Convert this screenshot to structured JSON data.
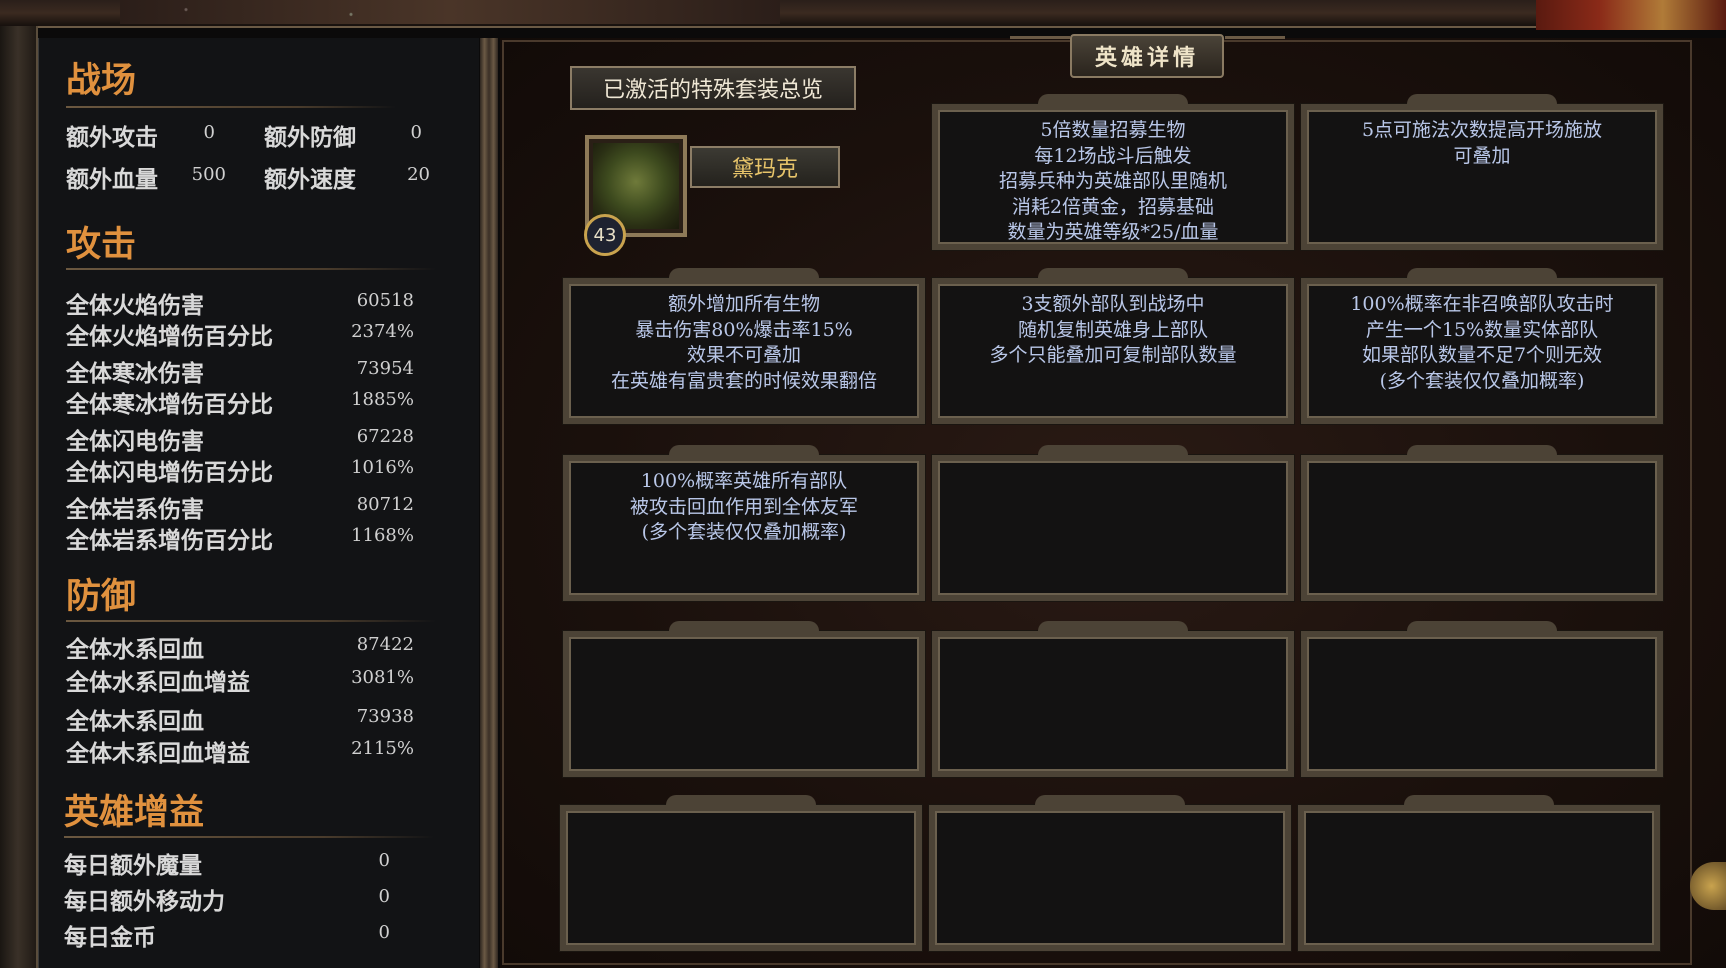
{
  "header": {
    "title": "英雄详情"
  },
  "overview_button": "已激活的特殊套装总览",
  "hero": {
    "name": "黛玛克",
    "level": "43"
  },
  "battlefield": {
    "title": "战场",
    "stats": [
      {
        "label": "额外攻击",
        "value": "0"
      },
      {
        "label": "额外防御",
        "value": "0"
      },
      {
        "label": "额外血量",
        "value": "500"
      },
      {
        "label": "额外速度",
        "value": "20"
      }
    ]
  },
  "attack": {
    "title": "攻击",
    "stats": [
      {
        "label": "全体火焰伤害",
        "value": "60518"
      },
      {
        "label": "全体火焰增伤百分比",
        "value": "2374%"
      },
      {
        "label": "全体寒冰伤害",
        "value": "73954"
      },
      {
        "label": "全体寒冰增伤百分比",
        "value": "1885%"
      },
      {
        "label": "全体闪电伤害",
        "value": "67228"
      },
      {
        "label": "全体闪电增伤百分比",
        "value": "1016%"
      },
      {
        "label": "全体岩系伤害",
        "value": "80712"
      },
      {
        "label": "全体岩系增伤百分比",
        "value": "1168%"
      }
    ]
  },
  "defense": {
    "title": "防御",
    "stats": [
      {
        "label": "全体水系回血",
        "value": "87422"
      },
      {
        "label": "全体水系回血增益",
        "value": "3081%"
      },
      {
        "label": "全体木系回血",
        "value": "73938"
      },
      {
        "label": "全体木系回血增益",
        "value": "2115%"
      }
    ]
  },
  "hero_buffs": {
    "title": "英雄增益",
    "stats": [
      {
        "label": "每日额外魔量",
        "value": "0"
      },
      {
        "label": "每日额外移动力",
        "value": "0"
      },
      {
        "label": "每日金币",
        "value": "0"
      }
    ]
  },
  "cards": [
    "5倍数量招募生物\n每12场战斗后触发\n招募兵种为英雄部队里随机\n消耗2倍黄金，招募基础\n数量为英雄等级*25/血量",
    "5点可施法次数提高开场施放\n可叠加",
    "额外增加所有生物\n暴击伤害80%爆击率15%\n效果不可叠加\n在英雄有富贵套的时候效果翻倍",
    "3支额外部队到战场中\n随机复制英雄身上部队\n多个只能叠加可复制部队数量",
    "100%概率在非召唤部队攻击时\n产生一个15%数量实体部队\n如果部队数量不足7个则无效\n(多个套装仅仅叠加概率)",
    "100%概率英雄所有部队\n被攻击回血作用到全体友军\n(多个套装仅仅叠加概率)",
    "",
    "",
    "",
    "",
    "",
    "",
    "",
    "",
    ""
  ]
}
